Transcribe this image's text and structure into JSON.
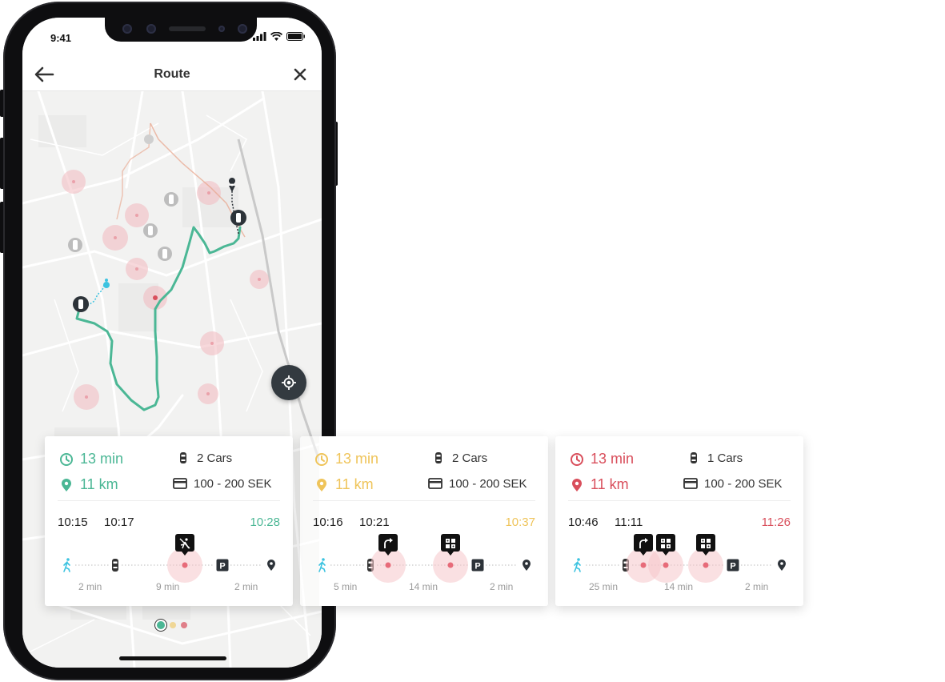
{
  "status_bar": {
    "time": "9:41"
  },
  "nav": {
    "title": "Route"
  },
  "colors": {
    "green": "#4bb795",
    "yellow": "#efc45a",
    "red": "#d94f5c",
    "walk": "#3cc3e0"
  },
  "cards": [
    {
      "duration": "13 min",
      "distance": "11 km",
      "cars": "2 Cars",
      "price": "100 - 200 SEK",
      "time_start": "10:15",
      "time_mid": "10:17",
      "time_end": "10:28",
      "durations": [
        "2 min",
        "9 min",
        "2 min"
      ],
      "accent": "#4bb795",
      "events": [
        "no-walking-icon"
      ]
    },
    {
      "duration": "13 min",
      "distance": "11 km",
      "cars": "2 Cars",
      "price": "100 - 200 SEK",
      "time_start": "10:16",
      "time_mid": "10:21",
      "time_end": "10:37",
      "durations": [
        "5 min",
        "14 min",
        "2 min"
      ],
      "accent": "#efc45a",
      "events": [
        "turn-right-icon",
        "traffic-light-icon"
      ]
    },
    {
      "duration": "13 min",
      "distance": "11 km",
      "cars": "1 Cars",
      "price": "100 - 200 SEK",
      "time_start": "10:46",
      "time_mid": "11:11",
      "time_end": "11:26",
      "durations": [
        "25 min",
        "14 min",
        "2 min"
      ],
      "accent": "#d94f5c",
      "events": [
        "turn-right-icon",
        "traffic-light-icon",
        "traffic-light-icon"
      ]
    }
  ]
}
